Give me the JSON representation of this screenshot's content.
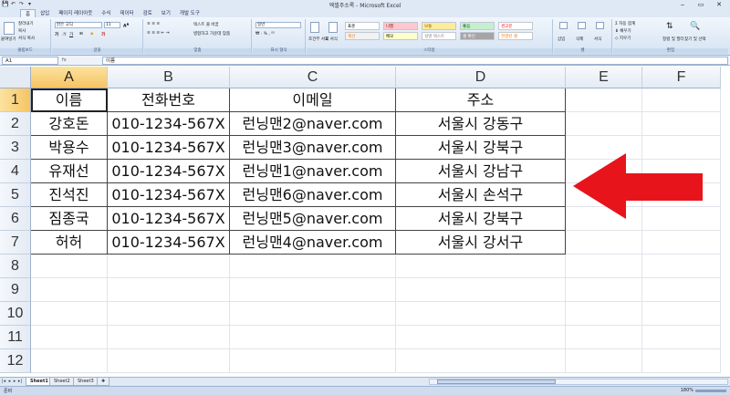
{
  "window": {
    "title": "엑셀주소록 - Microsoft Excel",
    "controls": [
      "‒",
      "▭",
      "✕"
    ]
  },
  "quick_access": [
    "💾",
    "↶",
    "↷",
    "▾"
  ],
  "ribbon": {
    "tabs": [
      "홈",
      "삽입",
      "페이지 레이아웃",
      "수식",
      "데이터",
      "검토",
      "보기",
      "개발 도구"
    ],
    "active_tab": "홈",
    "groups": {
      "clipboard": {
        "label": "클립보드",
        "paste": "붙여넣기",
        "cut": "잘라내기",
        "copy": "복사",
        "format_painter": "서식 복사"
      },
      "font": {
        "label": "글꼴",
        "font_name": "맑은 고딕",
        "font_size": "11"
      },
      "alignment": {
        "label": "맞춤",
        "wrap": "텍스트 줄 바꿈",
        "merge": "병합하고 가운데 맞춤"
      },
      "number": {
        "label": "표시 형식",
        "format": "일반"
      },
      "styles": {
        "label": "스타일",
        "conditional": "조건부 서식",
        "table": "표 서식",
        "cells": [
          {
            "name": "표준",
            "bg": "#ffffff",
            "fg": "#000000"
          },
          {
            "name": "나쁨",
            "bg": "#ffc7ce",
            "fg": "#9c0006"
          },
          {
            "name": "보통",
            "bg": "#ffeb9c",
            "fg": "#9c6500"
          },
          {
            "name": "좋음",
            "bg": "#c6efce",
            "fg": "#006100"
          },
          {
            "name": "경고문",
            "bg": "#ffffff",
            "fg": "#ff0000"
          },
          {
            "name": "계산",
            "bg": "#f2f2f2",
            "fg": "#fa7d00"
          },
          {
            "name": "메모",
            "bg": "#ffffcc",
            "fg": "#000000"
          },
          {
            "name": "설명 텍스트",
            "bg": "#ffffff",
            "fg": "#7f7f7f"
          },
          {
            "name": "셀 확인",
            "bg": "#a5a5a5",
            "fg": "#ffffff"
          },
          {
            "name": "연결된 셀",
            "bg": "#ffffff",
            "fg": "#fa7d00"
          }
        ]
      },
      "cells": {
        "label": "셀",
        "insert": "삽입",
        "delete": "삭제",
        "format": "서식"
      },
      "editing": {
        "label": "편집",
        "autosum": "자동 합계",
        "fill": "채우기",
        "clear": "지우기",
        "sort": "정렬 및 필터",
        "find": "찾기 및 선택"
      }
    }
  },
  "formula_bar": {
    "name_box": "A1",
    "fx": "fx",
    "content": "이름"
  },
  "sheet": {
    "columns": [
      "A",
      "B",
      "C",
      "D",
      "E",
      "F"
    ],
    "selected_column": "A",
    "rows": [
      "1",
      "2",
      "3",
      "4",
      "5",
      "6",
      "7",
      "8",
      "9",
      "10",
      "11",
      "12"
    ],
    "selected_row": "1",
    "active_cell": "A1",
    "table": [
      [
        "이름",
        "전화번호",
        "이메일",
        "주소"
      ],
      [
        "강호돈",
        "010-1234-567X",
        "런닝맨2@naver.com",
        "서울시 강동구"
      ],
      [
        "박용수",
        "010-1234-567X",
        "런닝맨3@naver.com",
        "서울시 강북구"
      ],
      [
        "유재선",
        "010-1234-567X",
        "런닝맨1@naver.com",
        "서울시 강남구"
      ],
      [
        "진석진",
        "010-1234-567X",
        "런닝맨6@naver.com",
        "서울시 손석구"
      ],
      [
        "짐종국",
        "010-1234-567X",
        "런닝맨5@naver.com",
        "서울시 강북구"
      ],
      [
        "허허",
        "010-1234-567X",
        "런닝맨4@naver.com",
        "서울시 강서구"
      ]
    ]
  },
  "annotation": {
    "arrow_color": "#e8141c"
  },
  "sheet_tabs": [
    "Sheet1",
    "Sheet2",
    "Sheet3"
  ],
  "active_sheet": "Sheet1",
  "status": {
    "mode": "준비",
    "zoom": "180%"
  }
}
